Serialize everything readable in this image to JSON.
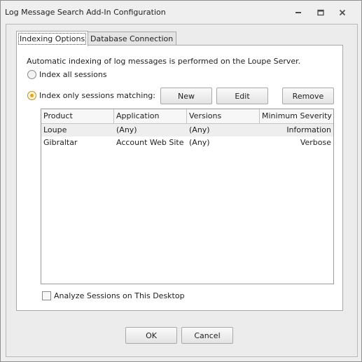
{
  "window": {
    "title": "Log Message Search Add-In Configuration"
  },
  "tabs": [
    {
      "label": "Indexing Options",
      "active": true
    },
    {
      "label": "Database Connection",
      "active": false
    }
  ],
  "indexing": {
    "description": "Automatic indexing of log messages is performed on the Loupe Server.",
    "radio_all": {
      "label": "Index all sessions",
      "checked": false
    },
    "radio_matching": {
      "label": "Index only sessions matching:",
      "checked": true
    },
    "buttons": {
      "new": "New",
      "edit": "Edit",
      "remove": "Remove"
    },
    "grid": {
      "columns": [
        "Product",
        "Application",
        "Versions",
        "Minimum Severity"
      ],
      "rows": [
        {
          "product": "Loupe",
          "application": "(Any)",
          "versions": "(Any)",
          "severity": "Information",
          "selected": true
        },
        {
          "product": "Gibraltar",
          "application": "Account Web Site",
          "versions": "(Any)",
          "severity": "Verbose",
          "selected": false
        }
      ]
    },
    "analyze_checkbox": {
      "label": "Analyze Sessions on This Desktop",
      "checked": false
    }
  },
  "footer": {
    "ok": "OK",
    "cancel": "Cancel"
  },
  "icons": [
    "minimize-icon",
    "restore-icon",
    "close-icon"
  ]
}
